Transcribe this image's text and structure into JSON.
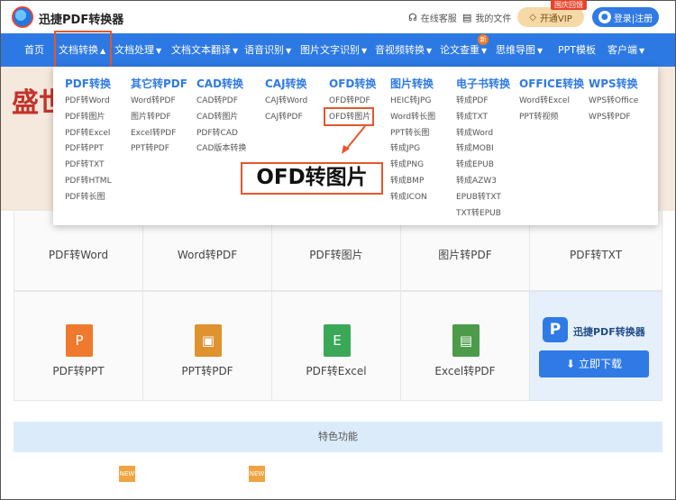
{
  "header": {
    "brand": "迅捷PDF转换器",
    "online_service": "在线客服",
    "my_files": "我的文件",
    "vip_label": "开通VIP",
    "vip_badge": "国庆回馈",
    "login_label": "登录|注册"
  },
  "nav": {
    "items": [
      {
        "label": "首页",
        "caret": false
      },
      {
        "label": "文档转换",
        "caret": true
      },
      {
        "label": "文档处理",
        "caret": true
      },
      {
        "label": "文档文本翻译",
        "caret": true
      },
      {
        "label": "语音识别",
        "caret": true
      },
      {
        "label": "图片文字识别",
        "caret": true
      },
      {
        "label": "音视频转换",
        "caret": true
      },
      {
        "label": "论文查重",
        "caret": true
      },
      {
        "label": "思维导图",
        "caret": true
      },
      {
        "label": "PPT模板",
        "caret": false
      },
      {
        "label": "客户端",
        "caret": true
      }
    ],
    "new_badge": "新",
    "active": "文档转换"
  },
  "dropdown": {
    "columns": [
      {
        "title": "PDF转换",
        "items": [
          "PDF转Word",
          "PDF转图片",
          "PDF转Excel",
          "PDF转PPT",
          "PDF转TXT",
          "PDF转HTML",
          "PDF转长图"
        ]
      },
      {
        "title": "其它转PDF",
        "items": [
          "Word转PDF",
          "图片转PDF",
          "Excel转PDF",
          "PPT转PDF"
        ]
      },
      {
        "title": "CAD转换",
        "items": [
          "CAD转PDF",
          "CAD转图片",
          "PDF转CAD",
          "CAD版本转换"
        ]
      },
      {
        "title": "CAJ转换",
        "items": [
          "CAJ转Word",
          "CAJ转PDF"
        ]
      },
      {
        "title": "OFD转换",
        "items": [
          "OFD转PDF",
          "OFD转图片"
        ]
      },
      {
        "title": "图片转换",
        "items": [
          "HEIC转JPG",
          "Word转长图",
          "PPT转长图",
          "转成JPG",
          "转成PNG",
          "转成BMP",
          "转成ICON"
        ]
      },
      {
        "title": "电子书转换",
        "items": [
          "转成PDF",
          "转成TXT",
          "转成Word",
          "转成MOBI",
          "转成EPUB",
          "转成AZW3",
          "EPUB转TXT",
          "TXT转EPUB"
        ]
      },
      {
        "title": "OFFICE转换",
        "items": [
          "Word转Excel",
          "PPT转视频"
        ]
      },
      {
        "title": "WPS转换",
        "items": [
          "WPS转Office",
          "WPS转PDF"
        ]
      }
    ],
    "highlighted": "OFD转图片",
    "callout": "OFD转图片"
  },
  "hero": {
    "text": "盛世"
  },
  "cards_row1": [
    "PDF转Word",
    "Word转PDF",
    "PDF转图片",
    "图片转PDF",
    "PDF转TXT"
  ],
  "cards_row2": [
    {
      "label": "PDF转PPT",
      "icon": "P",
      "color": "#ef7a2e"
    },
    {
      "label": "PPT转PDF",
      "icon": "▣",
      "color": "#e0922f"
    },
    {
      "label": "PDF转Excel",
      "icon": "E",
      "color": "#3aa857"
    },
    {
      "label": "Excel转PDF",
      "icon": "▤",
      "color": "#4c9b4a"
    }
  ],
  "promo": {
    "logo": "P",
    "title": "迅捷PDF转换器",
    "button": "立即下载"
  },
  "feature_bar": "特色功能",
  "new_tag": "NEW",
  "colors": {
    "nav_blue": "#2d79e3",
    "accent_orange": "#e4572b",
    "link_blue": "#2f7ae5"
  }
}
